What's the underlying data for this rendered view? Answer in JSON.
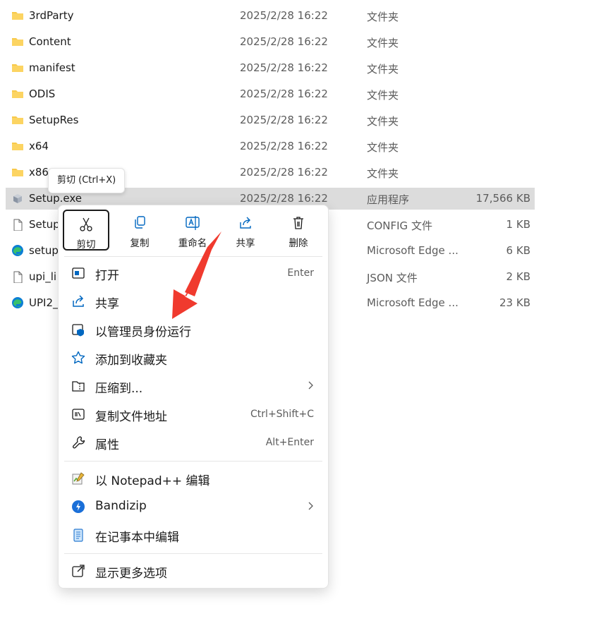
{
  "files": [
    {
      "name": "3rdParty",
      "date": "2025/2/28 16:22",
      "type": "文件夹",
      "size": "",
      "icon": "folder-icon"
    },
    {
      "name": "Content",
      "date": "2025/2/28 16:22",
      "type": "文件夹",
      "size": "",
      "icon": "folder-icon"
    },
    {
      "name": "manifest",
      "date": "2025/2/28 16:22",
      "type": "文件夹",
      "size": "",
      "icon": "folder-icon"
    },
    {
      "name": "ODIS",
      "date": "2025/2/28 16:22",
      "type": "文件夹",
      "size": "",
      "icon": "folder-icon"
    },
    {
      "name": "SetupRes",
      "date": "2025/2/28 16:22",
      "type": "文件夹",
      "size": "",
      "icon": "folder-icon"
    },
    {
      "name": "x64",
      "date": "2025/2/28 16:22",
      "type": "文件夹",
      "size": "",
      "icon": "folder-icon"
    },
    {
      "name": "x86",
      "date": "2025/2/28 16:22",
      "type": "文件夹",
      "size": "",
      "icon": "folder-icon"
    },
    {
      "name": "Setup.exe",
      "date": "2025/2/28 16:22",
      "type": "应用程序",
      "size": "17,566 KB",
      "icon": "installer-icon"
    },
    {
      "name": "Setup",
      "date": "",
      "type": "CONFIG 文件",
      "size": "1 KB",
      "icon": "file-icon"
    },
    {
      "name": "setup",
      "date": "",
      "type": "Microsoft Edge ...",
      "size": "6 KB",
      "icon": "edge-icon"
    },
    {
      "name": "upi_li",
      "date": "",
      "type": "JSON 文件",
      "size": "2 KB",
      "icon": "file-icon"
    },
    {
      "name": "UPI2_",
      "date": "",
      "type": "Microsoft Edge ...",
      "size": "23 KB",
      "icon": "edge-icon"
    }
  ],
  "tooltip": "剪切 (Ctrl+X)",
  "quick_actions": [
    {
      "label": "剪切",
      "icon": "scissors-icon"
    },
    {
      "label": "复制",
      "icon": "copy-icon"
    },
    {
      "label": "重命名",
      "icon": "rename-icon"
    },
    {
      "label": "共享",
      "icon": "share-icon"
    },
    {
      "label": "删除",
      "icon": "trash-icon"
    }
  ],
  "menu_items": [
    {
      "label": "打开",
      "shortcut": "Enter",
      "icon": "open-icon"
    },
    {
      "label": "共享",
      "shortcut": "",
      "icon": "share-icon"
    },
    {
      "label": "以管理员身份运行",
      "shortcut": "",
      "icon": "shield-icon"
    },
    {
      "label": "添加到收藏夹",
      "shortcut": "",
      "icon": "star-icon"
    },
    {
      "label": "压缩到...",
      "shortcut": "",
      "icon": "zip-folder-icon"
    },
    {
      "label": "复制文件地址",
      "shortcut": "Ctrl+Shift+C",
      "icon": "copy-path-icon"
    },
    {
      "label": "属性",
      "shortcut": "Alt+Enter",
      "icon": "wrench-icon"
    },
    {
      "label": "以 Notepad++ 编辑",
      "shortcut": "",
      "icon": "notepadpp-icon"
    },
    {
      "label": "Bandizip",
      "shortcut": "",
      "icon": "bandizip-icon"
    },
    {
      "label": "在记事本中编辑",
      "shortcut": "",
      "icon": "notepad-icon"
    },
    {
      "label": "显示更多选项",
      "shortcut": "",
      "icon": "more-options-icon"
    }
  ],
  "colors": {
    "accent": "#0067c0",
    "arrow": "#f03a2e",
    "folder": "#f8c94a",
    "selection": "#dcdcdc"
  }
}
